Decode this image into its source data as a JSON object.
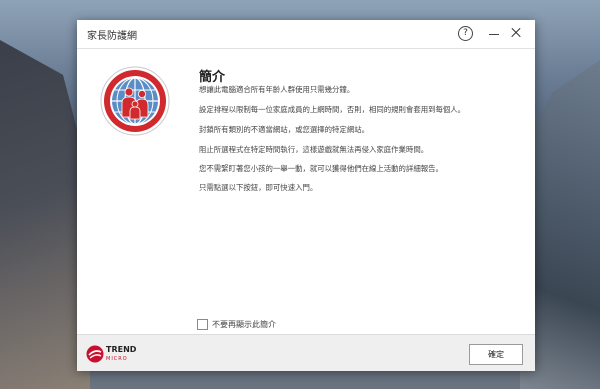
{
  "window": {
    "title": "家長防護網",
    "help_symbol": "?"
  },
  "intro": {
    "heading": "簡介",
    "paragraphs": [
      "想讓此電腦適合所有年齡人群使用只需幾分鐘。",
      "設定排程以限制每一位家庭成員的上網時間，否則，相同的規則會套用到每個人。",
      "封鎖所有類別的不適當網站，或您選擇的特定網站。",
      "阻止所選程式在特定時間執行，這樣遊戲就無法再侵入家庭作業時間。",
      "您不需緊盯著您小孩的一舉一動，就可以獲得他們在線上活動的詳細報告。",
      "只需點選以下按鈕，即可快速入門。"
    ]
  },
  "options": {
    "dont_show_label": "不要再顯示此簡介",
    "dont_show_checked": false
  },
  "footer": {
    "brand_name": "TREND",
    "brand_sub": "MICRO",
    "ok_label": "確定"
  },
  "icons": {
    "hero": "family-globe-icon",
    "help": "help-icon",
    "minimize": "minimize-icon",
    "close": "close-icon",
    "logo": "trend-micro-logo-icon"
  },
  "colors": {
    "brand_red": "#c8102e",
    "globe_blue": "#5a8cc6"
  }
}
